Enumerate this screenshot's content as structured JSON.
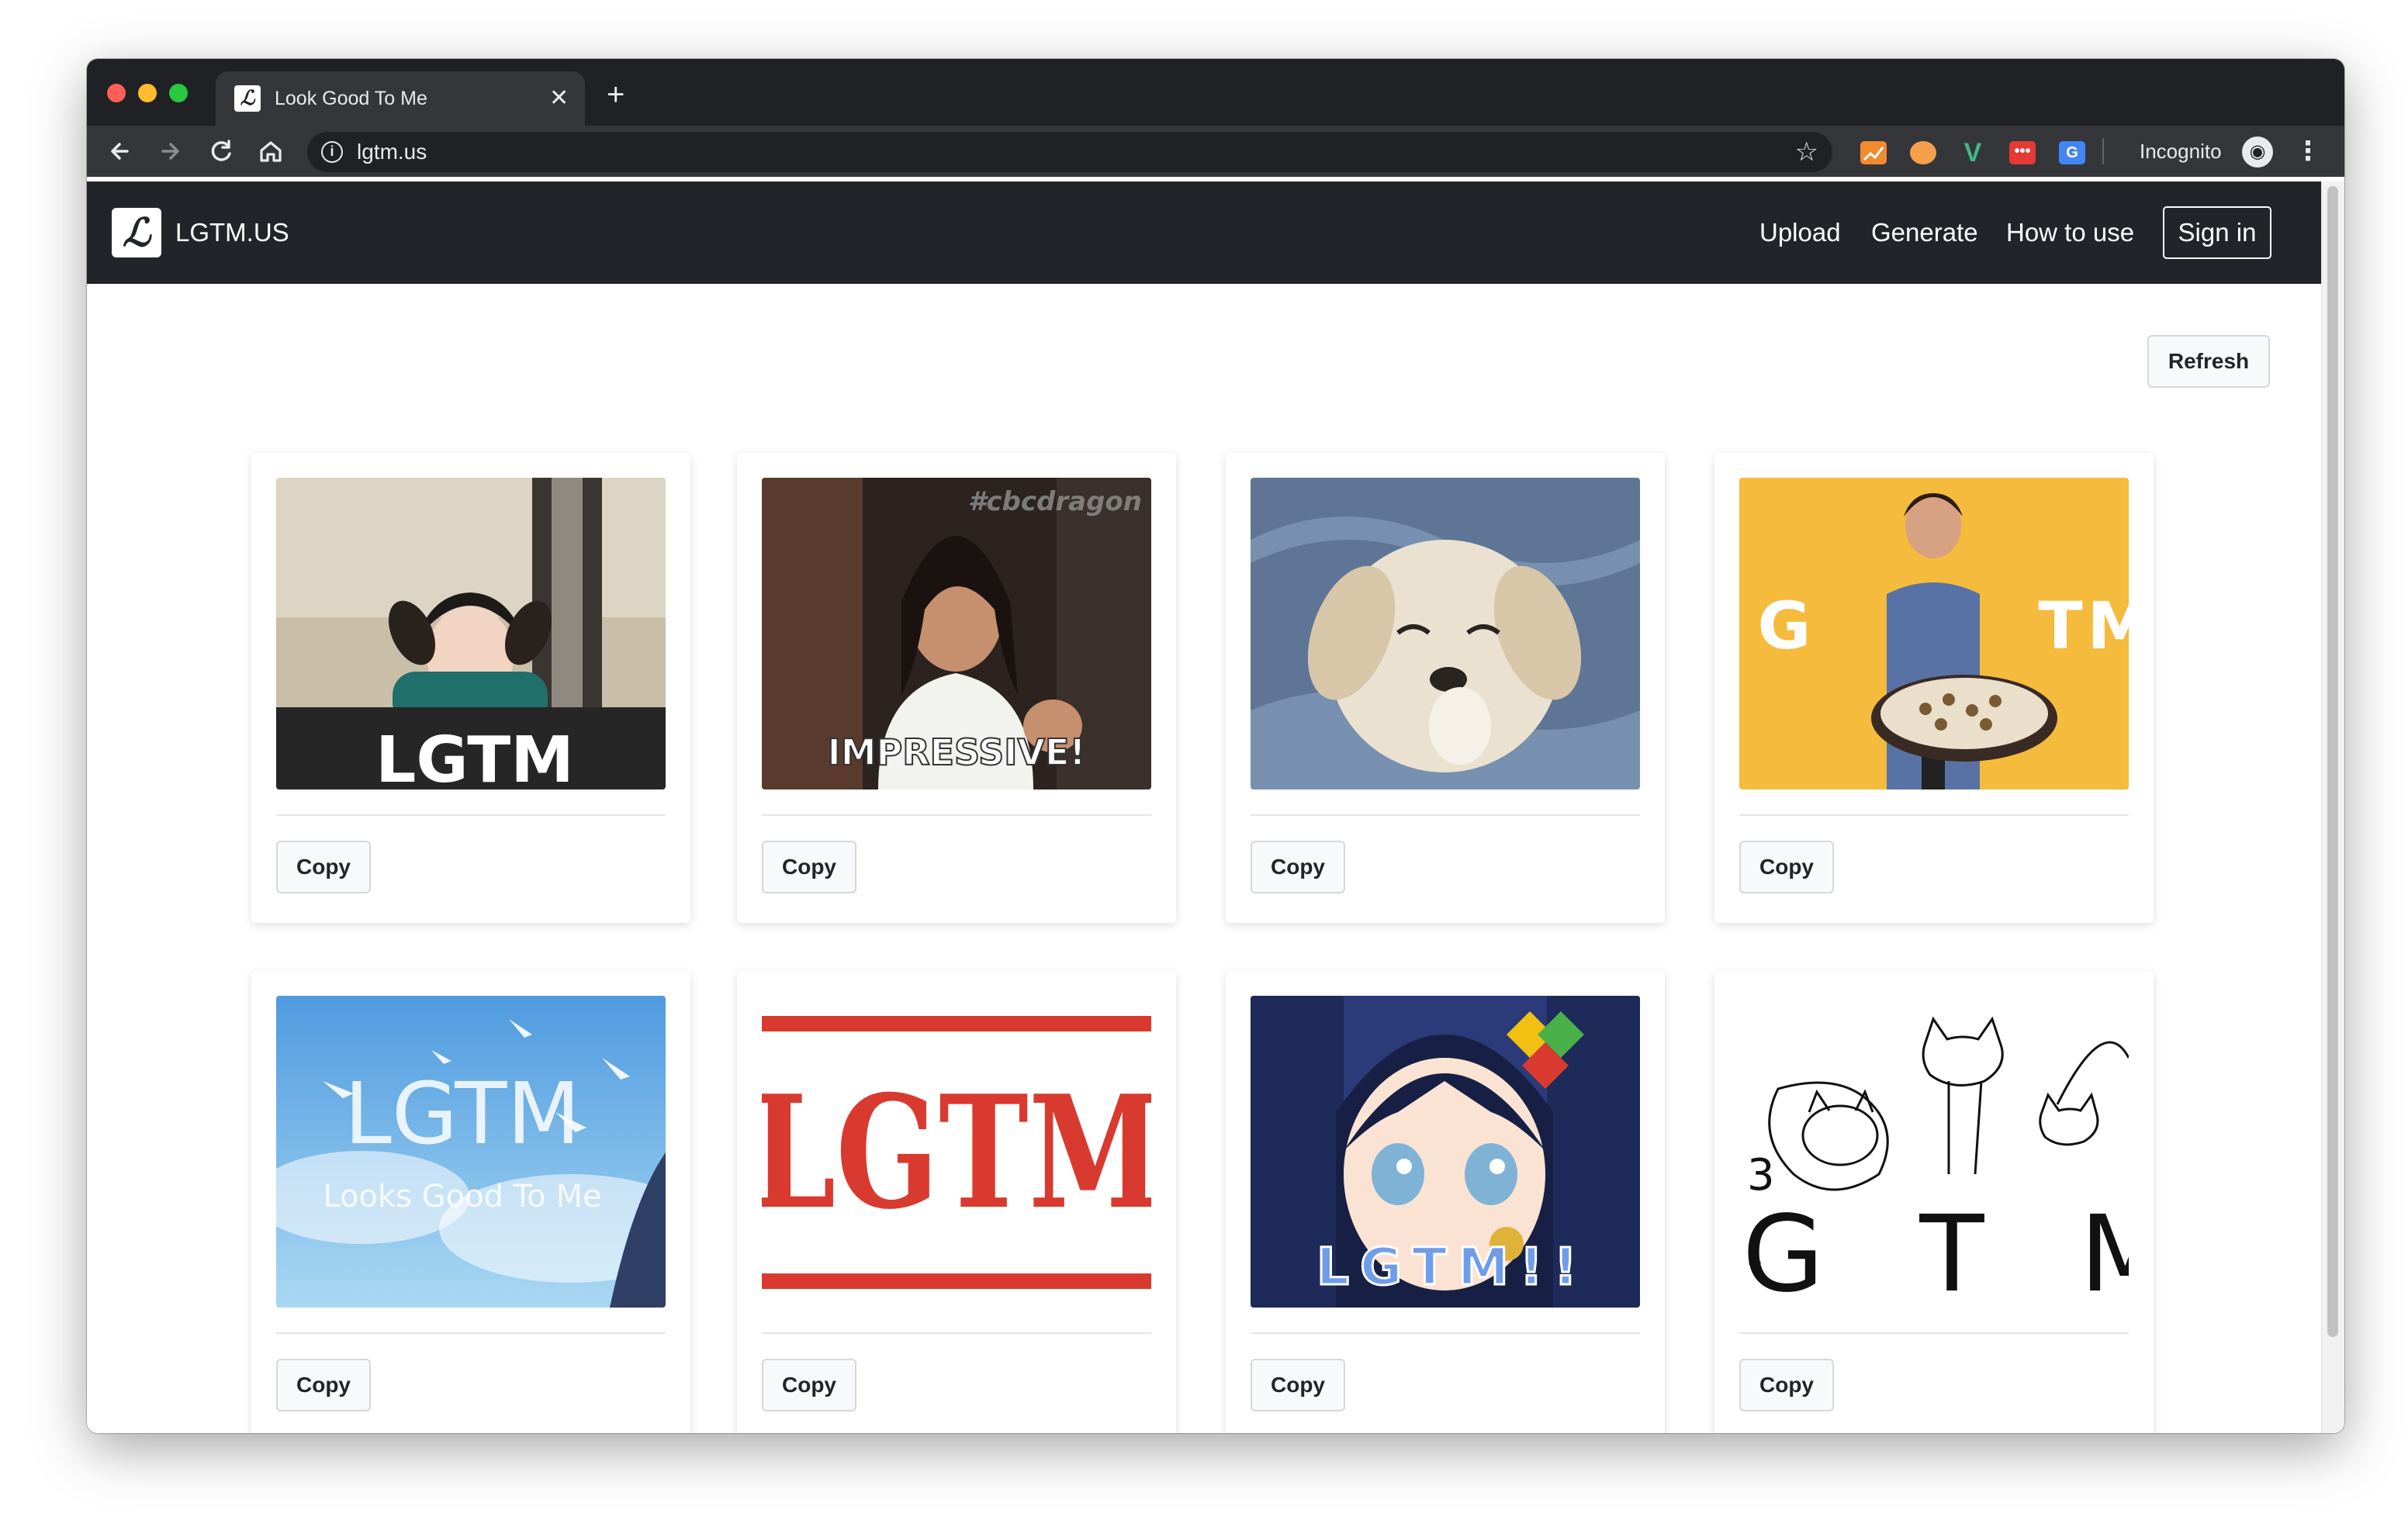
{
  "browser": {
    "tab_title": "Look Good To Me",
    "tab_close": "✕",
    "new_tab": "+",
    "favicon_letter": "ℒ",
    "url": "lgtm.us",
    "incognito_label": "Incognito",
    "icons": {
      "back": "arrow-left-icon",
      "forward": "arrow-right-icon",
      "reload": "reload-icon",
      "home": "home-icon",
      "info": "info-icon",
      "star": "star-icon",
      "menu": "kebab-menu-icon"
    },
    "extensions": [
      {
        "name": "chart-extension-icon",
        "color": "#f28b30"
      },
      {
        "name": "orange-circle-extension-icon",
        "color": "#f5a04a"
      },
      {
        "name": "vue-devtools-extension-icon",
        "color": "#41b883"
      },
      {
        "name": "red-dots-extension-icon",
        "color": "#e53935"
      },
      {
        "name": "translate-extension-icon",
        "color": "#4285f4"
      }
    ]
  },
  "navbar": {
    "brand_logo_letter": "ℒ",
    "brand": "LGTM.US",
    "links": [
      "Upload",
      "Generate",
      "How to use"
    ],
    "signin": "Sign in"
  },
  "main": {
    "refresh_label": "Refresh",
    "copy_label": "Copy",
    "cards": [
      {
        "overlay": "LGTM"
      },
      {
        "overlay": "IMPRESSIVE!",
        "watermark": "#cbcdragon"
      },
      {
        "overlay": ""
      },
      {
        "overlay": "G   T M"
      },
      {
        "overlay": "LGTM",
        "subtitle": "Looks Good To Me"
      },
      {
        "overlay": "LGTM"
      },
      {
        "overlay": "LGTM!!"
      },
      {
        "overlay": "G T M"
      }
    ]
  },
  "colors": {
    "chrome_dark": "#202124",
    "chrome_toolbar": "#35363a",
    "navbar": "#212529",
    "lgtm_red": "#d93a2f",
    "yellow_bg": "#f5bb3c"
  }
}
